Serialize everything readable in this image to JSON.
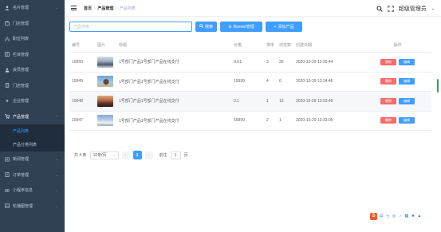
{
  "sidebar": {
    "items": [
      {
        "label": "名片管理",
        "icon": "user-icon"
      },
      {
        "label": "门店管理",
        "icon": "store-icon"
      },
      {
        "label": "职位列表",
        "icon": "sitemap-icon"
      },
      {
        "label": "栏目管理",
        "icon": "columns-icon"
      },
      {
        "label": "会员管理",
        "icon": "member-icon"
      },
      {
        "label": "门店管理",
        "icon": "building-icon"
      },
      {
        "label": "企业管理",
        "icon": "star-icon"
      },
      {
        "label": "产品管理",
        "icon": "cart-icon"
      }
    ],
    "submenu": [
      {
        "label": "产品列表",
        "active": true
      },
      {
        "label": "产品分类列表",
        "active": false
      }
    ],
    "items_after": [
      {
        "label": "新闻管理",
        "icon": "news-icon"
      },
      {
        "label": "订单管理",
        "icon": "order-icon"
      },
      {
        "label": "小程序信息",
        "icon": "mini-program-icon"
      },
      {
        "label": "轮播图管理",
        "icon": "image-icon"
      }
    ]
  },
  "header": {
    "breadcrumb": [
      "首页",
      "产品管理",
      "产品列表"
    ],
    "username": "超级管理员"
  },
  "toolbar": {
    "search_placeholder": "产品搜索",
    "search_label": "搜索",
    "banner_label": "Banner管理",
    "add_label": "添加产品"
  },
  "table": {
    "headers": [
      "编号",
      "图片",
      "标题",
      "价格",
      "排序",
      "浏览数",
      "创建日期",
      "操作"
    ],
    "rows": [
      {
        "id": "10950",
        "title": "1号部门产品1号部门产品在线支付",
        "price": "0.01",
        "sort": "3",
        "views": "26",
        "date": "2020-10-29 13:35:44",
        "thumb": "snow-forest"
      },
      {
        "id": "10949",
        "title": "1号部门产品1号部门产品在线支付",
        "price": "19999",
        "sort": "4",
        "views": "6",
        "date": "2020-10-29 13:34:46",
        "thumb": "sky-bird"
      },
      {
        "id": "10948",
        "title": "1号部门产品1号部门产品在线支付",
        "price": "0.1",
        "sort": "1",
        "views": "13",
        "date": "2020-10-29 13:33:49",
        "thumb": "dusk-landscape"
      },
      {
        "id": "10947",
        "title": "1号部门产品1号部门产品在线支付",
        "price": "59999",
        "sort": "2",
        "views": "1",
        "date": "2020-10-29 13:33:05",
        "thumb": "winter-field"
      }
    ],
    "delete_label": "删除",
    "edit_label": "编辑"
  },
  "pagination": {
    "total": "共 4 条",
    "page_size": "10条/页",
    "current": "1",
    "goto_label": "前往",
    "goto_value": "1",
    "page_unit": "页"
  },
  "colors": {
    "sidebar_bg": "#304156",
    "primary": "#409eff",
    "danger": "#f56c6c"
  },
  "ime": {
    "items": [
      "中",
      "ㄅ",
      "◎",
      "♪",
      "▦",
      "♣",
      "▲"
    ]
  }
}
